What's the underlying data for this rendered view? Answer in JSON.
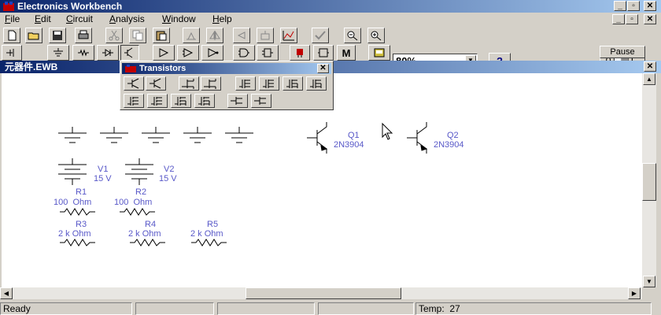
{
  "app": {
    "title": "Electronics Workbench"
  },
  "menu": [
    "File",
    "Edit",
    "Circuit",
    "Analysis",
    "Window",
    "Help"
  ],
  "menu_underline": [
    "F",
    "E",
    "C",
    "A",
    "W",
    "H"
  ],
  "toolbar": {
    "zoom": "80%",
    "help_label": "?",
    "pause_label": "Pause"
  },
  "document": {
    "title": "元器件.EWB"
  },
  "palette": {
    "title": "Transistors"
  },
  "components": {
    "q1": {
      "name": "Q1",
      "model": "2N3904"
    },
    "q2": {
      "name": "Q2",
      "model": "2N3904"
    },
    "v1": {
      "name": "V1",
      "value": "15 V"
    },
    "v2": {
      "name": "V2",
      "value": "15 V"
    },
    "r1": {
      "name": "R1",
      "value": "100  Ohm"
    },
    "r2": {
      "name": "R2",
      "value": "100  Ohm"
    },
    "r3": {
      "name": "R3",
      "value": "2 k Ohm"
    },
    "r4": {
      "name": "R4",
      "value": "2 k Ohm"
    },
    "r5": {
      "name": "R5",
      "value": "2 k Ohm"
    }
  },
  "status": {
    "ready": "Ready",
    "temp": "Temp:  27"
  }
}
